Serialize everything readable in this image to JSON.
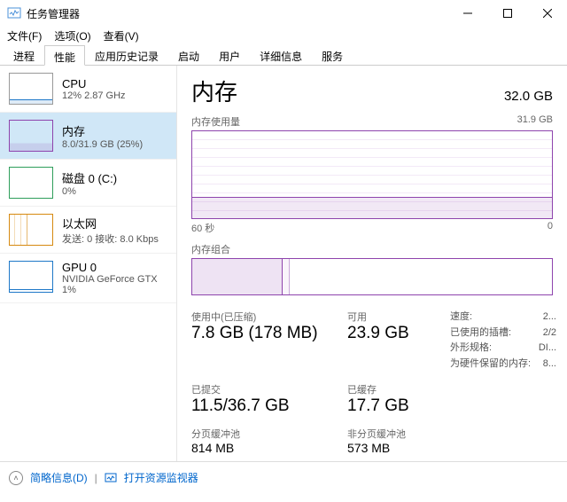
{
  "window": {
    "title": "任务管理器",
    "menu": {
      "file": "文件(F)",
      "options": "选项(O)",
      "view": "查看(V)"
    }
  },
  "tabs": {
    "processes": "进程",
    "performance": "性能",
    "app_history": "应用历史记录",
    "startup": "启动",
    "users": "用户",
    "details": "详细信息",
    "services": "服务"
  },
  "sidebar": {
    "cpu": {
      "title": "CPU",
      "sub": "12% 2.87 GHz"
    },
    "memory": {
      "title": "内存",
      "sub": "8.0/31.9 GB (25%)"
    },
    "disk": {
      "title": "磁盘 0 (C:)",
      "sub": "0%"
    },
    "ethernet": {
      "title": "以太网",
      "sub": "发送: 0 接收: 8.0 Kbps"
    },
    "gpu": {
      "title": "GPU 0",
      "sub": "NVIDIA GeForce GTX",
      "sub2": "1%"
    }
  },
  "main": {
    "title": "内存",
    "capacity": "32.0 GB",
    "usage_label": "内存使用量",
    "usage_max": "31.9 GB",
    "axis_left": "60 秒",
    "axis_right": "0",
    "composition_label": "内存组合",
    "stats": {
      "in_use_label": "使用中(已压缩)",
      "in_use": "7.8 GB (178 MB)",
      "available_label": "可用",
      "available": "23.9 GB",
      "committed_label": "已提交",
      "committed": "11.5/36.7 GB",
      "cached_label": "已缓存",
      "cached": "17.7 GB",
      "paged_label": "分页缓冲池",
      "paged": "814 MB",
      "nonpaged_label": "非分页缓冲池",
      "nonpaged": "573 MB"
    },
    "right": {
      "speed_label": "速度:",
      "speed": "2...",
      "slots_label": "已使用的插槽:",
      "slots": "2/2",
      "form_label": "外形规格:",
      "form": "DI...",
      "reserved_label": "为硬件保留的内存:",
      "reserved": "8..."
    }
  },
  "footer": {
    "fewer": "简略信息(D)",
    "open_monitor": "打开资源监视器"
  },
  "chart_data": {
    "type": "area",
    "title": "内存使用量",
    "ylabel": "GB",
    "ylim": [
      0,
      31.9
    ],
    "x_range_seconds": 60,
    "series": [
      {
        "name": "内存",
        "approx_constant_value": 8.0
      }
    ],
    "composition": {
      "type": "bar",
      "total": 31.9,
      "segments": [
        {
          "name": "使用中",
          "value": 7.8
        },
        {
          "name": "已压缩",
          "value": 0.178
        },
        {
          "name": "可用",
          "value": 23.9
        }
      ]
    }
  }
}
